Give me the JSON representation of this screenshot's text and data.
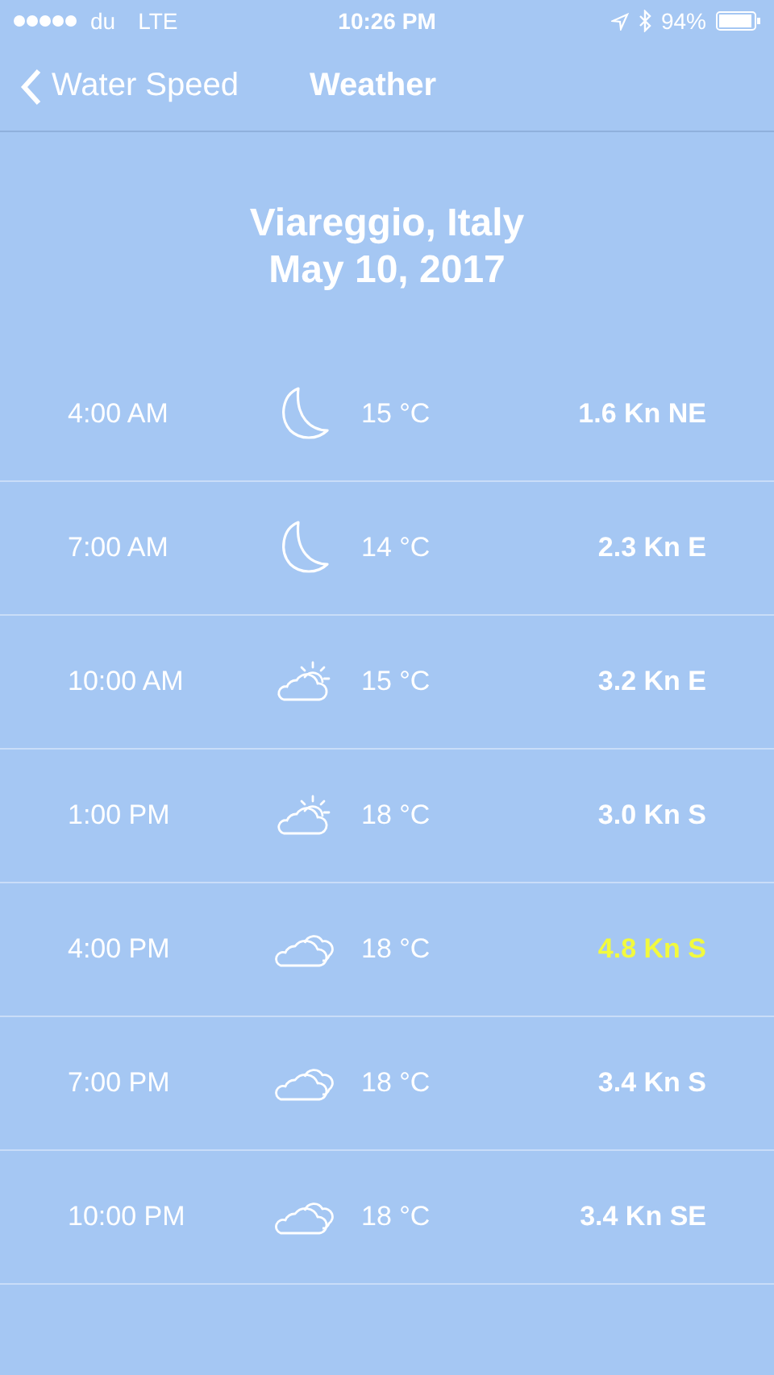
{
  "status_bar": {
    "carrier": "du",
    "network": "LTE",
    "time": "10:26 PM",
    "battery": "94%"
  },
  "nav": {
    "back": "Water Speed",
    "title": "Weather"
  },
  "header": {
    "location": "Viareggio, Italy",
    "date": "May 10, 2017"
  },
  "forecast": [
    {
      "time": "4:00 AM",
      "kind": "moon",
      "temperature": "15 °C",
      "wind": "1.6 Kn NE",
      "highlighted": false
    },
    {
      "time": "7:00 AM",
      "kind": "moon",
      "temperature": "14 °C",
      "wind": "2.3 Kn E",
      "highlighted": false
    },
    {
      "time": "10:00 AM",
      "kind": "partly-sunny",
      "temperature": "15 °C",
      "wind": "3.2 Kn E",
      "highlighted": false
    },
    {
      "time": "1:00 PM",
      "kind": "partly-sunny",
      "temperature": "18 °C",
      "wind": "3.0 Kn S",
      "highlighted": false
    },
    {
      "time": "4:00 PM",
      "kind": "cloudy",
      "temperature": "18 °C",
      "wind": "4.8 Kn S",
      "highlighted": true
    },
    {
      "time": "7:00 PM",
      "kind": "cloudy",
      "temperature": "18 °C",
      "wind": "3.4 Kn S",
      "highlighted": false
    },
    {
      "time": "10:00 PM",
      "kind": "cloudy",
      "temperature": "18 °C",
      "wind": "3.4 Kn SE",
      "highlighted": false
    }
  ]
}
